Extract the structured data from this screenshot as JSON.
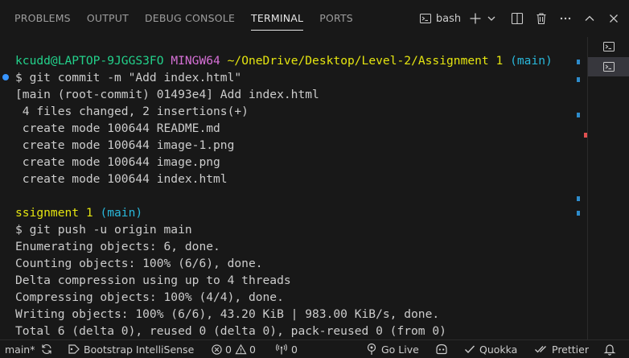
{
  "panel": {
    "tabs": [
      {
        "label": "PROBLEMS"
      },
      {
        "label": "OUTPUT"
      },
      {
        "label": "DEBUG CONSOLE"
      },
      {
        "label": "TERMINAL"
      },
      {
        "label": "PORTS"
      }
    ],
    "terminal_name": "bash"
  },
  "terminal": {
    "prompt1": {
      "user": "kcudd@LAPTOP-9JGGS3FO",
      "shell": "MINGW64",
      "path": "~/OneDrive/Desktop/Level-2/Assignment 1",
      "branch": "(main)"
    },
    "cmd1": "$ git commit -m \"Add index.html\"",
    "out1": [
      "[main (root-commit) 01493e4] Add index.html",
      " 4 files changed, 2 insertions(+)",
      " create mode 100644 README.md",
      " create mode 100644 image-1.png",
      " create mode 100644 image.png",
      " create mode 100644 index.html"
    ],
    "prompt2": {
      "path": "ssignment 1",
      "branch": "(main)"
    },
    "cmd2": "$ git push -u origin main",
    "out2": [
      "Enumerating objects: 6, done.",
      "Counting objects: 100% (6/6), done.",
      "Delta compression using up to 4 threads",
      "Compressing objects: 100% (4/4), done.",
      "Writing objects: 100% (6/6), 43.20 KiB | 983.00 KiB/s, done.",
      "Total 6 (delta 0), reused 0 (delta 0), pack-reused 0 (from 0)"
    ]
  },
  "statusbar": {
    "branch": "main*",
    "bootstrap": "Bootstrap IntelliSense",
    "errors": "0",
    "warnings": "0",
    "ports": "0",
    "golive": "Go Live",
    "quokka": "Quokka",
    "prettier": "Prettier"
  },
  "colors": {
    "background": "#181818",
    "prompt_user": "#23d18b",
    "prompt_shell": "#d670d6",
    "prompt_path": "#e5e510",
    "prompt_branch": "#29b8db",
    "ruler_blue": "#2e8ccc",
    "ruler_red": "#e05050"
  }
}
